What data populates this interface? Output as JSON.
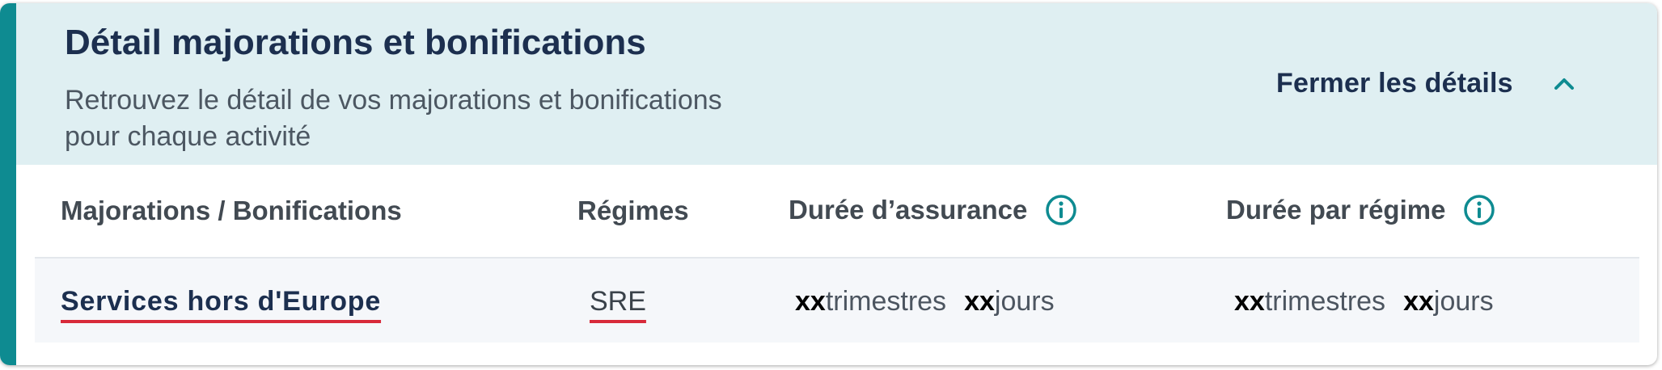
{
  "section": {
    "title": "Détail majorations et bonifications",
    "subtitle_line1": "Retrouvez le détail de vos majorations et bonifications",
    "subtitle_line2": "pour chaque activité",
    "toggle_label": "Fermer les détails",
    "toggle_icon": "chevron-up-icon"
  },
  "table": {
    "headers": {
      "majorations": "Majorations / Bonifications",
      "regimes": "Régimes",
      "duree_assurance": "Durée d’assurance",
      "duree_regime": "Durée par régime"
    },
    "rows": [
      {
        "activity": "Services hors d'Europe",
        "regime": "SRE",
        "duree_assurance": {
          "trimestres_value": "xx",
          "trimestres_unit": "trimestres",
          "jours_value": "xx",
          "jours_unit": "jours"
        },
        "duree_regime": {
          "trimestres_value": "xx",
          "trimestres_unit": "trimestres",
          "jours_value": "xx",
          "jours_unit": "jours"
        }
      }
    ]
  },
  "colors": {
    "accent": "#0e8b91",
    "header_bg": "#dfeff2",
    "title": "#1c2f4f",
    "underline": "#d82a3a",
    "row_bg": "#f5f7fa"
  }
}
